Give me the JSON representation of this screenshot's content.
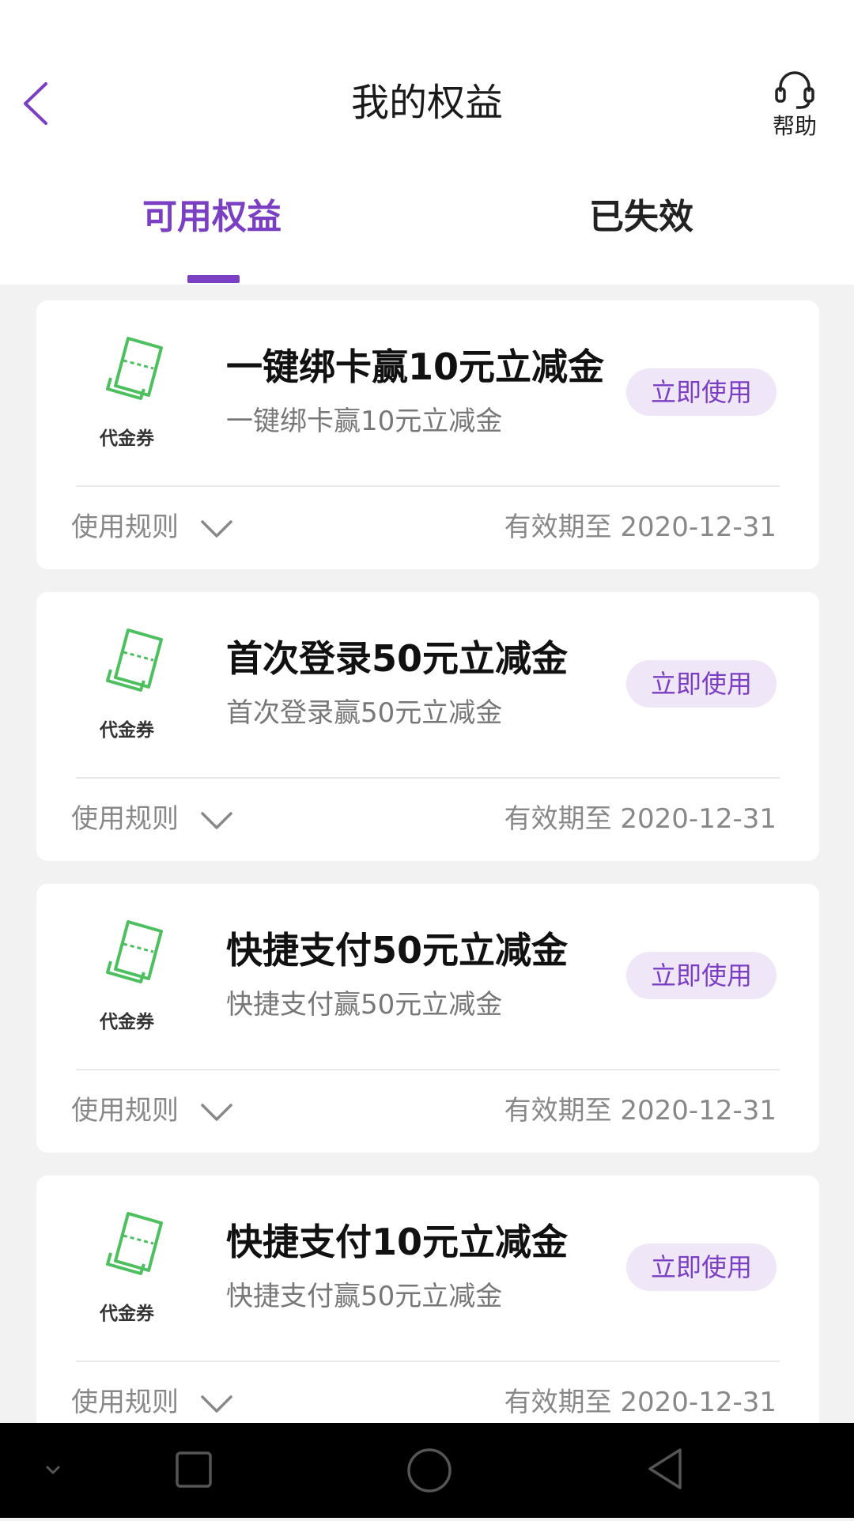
{
  "header": {
    "title": "我的权益",
    "help_label": "帮助"
  },
  "tabs": [
    {
      "label": "可用权益",
      "active": true
    },
    {
      "label": "已失效",
      "active": false
    }
  ],
  "coupons": [
    {
      "type_label": "代金券",
      "title": "一键绑卡赢10元立减金",
      "subtitle": "一键绑卡赢10元立减金",
      "button": "立即使用",
      "rules_label": "使用规则",
      "expiry": "有效期至 2020-12-31"
    },
    {
      "type_label": "代金券",
      "title": "首次登录50元立减金",
      "subtitle": "首次登录赢50元立减金",
      "button": "立即使用",
      "rules_label": "使用规则",
      "expiry": "有效期至 2020-12-31"
    },
    {
      "type_label": "代金券",
      "title": "快捷支付50元立减金",
      "subtitle": "快捷支付赢50元立减金",
      "button": "立即使用",
      "rules_label": "使用规则",
      "expiry": "有效期至 2020-12-31"
    },
    {
      "type_label": "代金券",
      "title": "快捷支付10元立减金",
      "subtitle": "快捷支付赢50元立减金",
      "button": "立即使用",
      "rules_label": "使用规则",
      "expiry": "有效期至 2020-12-31"
    }
  ],
  "colors": {
    "accent": "#7b3fc4",
    "accent_light": "#efe6f8",
    "ticket_green": "#4cbf5e",
    "background": "#f2f2f2"
  },
  "icons": {
    "back": "chevron-left-icon",
    "help": "headset-icon",
    "coupon": "ticket-icon",
    "expand": "chevron-down-icon"
  }
}
